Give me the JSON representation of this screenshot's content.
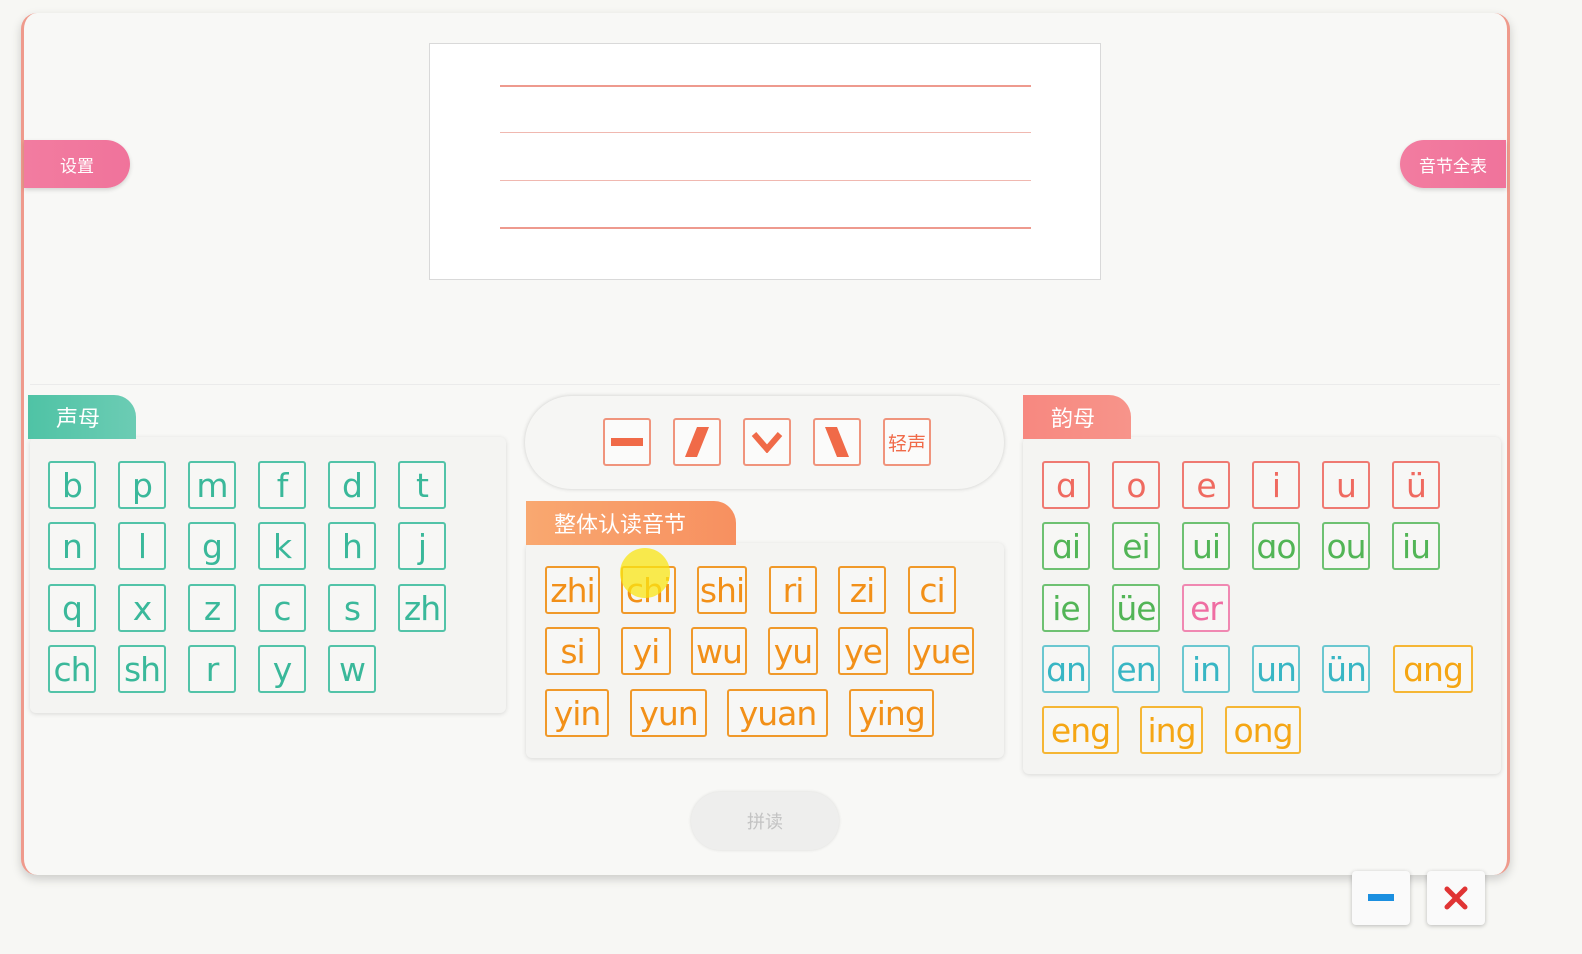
{
  "buttons": {
    "settings": "设置",
    "syllable_table": "音节全表",
    "read": "拼读"
  },
  "tones": [
    "—",
    "ˊ",
    "ˇ",
    "ˋ",
    "轻声"
  ],
  "initials": {
    "title": "声母",
    "keys": [
      "b",
      "p",
      "m",
      "f",
      "d",
      "t",
      "n",
      "l",
      "g",
      "k",
      "h",
      "j",
      "q",
      "x",
      "z",
      "c",
      "s",
      "zh",
      "ch",
      "sh",
      "r",
      "y",
      "w"
    ]
  },
  "whole_syllables": {
    "title": "整体认读音节",
    "keys": [
      "zhi",
      "chi",
      "shi",
      "ri",
      "zi",
      "ci",
      "si",
      "yi",
      "wu",
      "yu",
      "ye",
      "yue",
      "yin",
      "yun",
      "yuan",
      "ying"
    ]
  },
  "finals": {
    "title": "韵母",
    "keys": [
      "ɑ",
      "o",
      "e",
      "i",
      "u",
      "ü",
      "ɑi",
      "ei",
      "ui",
      "ɑo",
      "ou",
      "iu",
      "ie",
      "üe",
      "er",
      "ɑn",
      "en",
      "in",
      "un",
      "ün",
      "ɑng",
      "eng",
      "ing",
      "ong"
    ]
  },
  "colors": {
    "accent": "#f27ca0",
    "initials": "#3ab89a",
    "syllables": "#f29018",
    "finals": "#ef6a60"
  }
}
